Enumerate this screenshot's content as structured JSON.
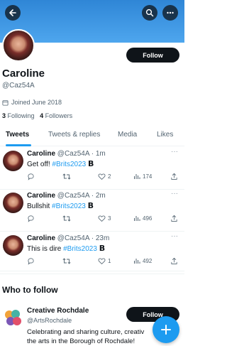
{
  "profile": {
    "name": "Caroline",
    "handle": "@Caz54A",
    "joined": "Joined June 2018",
    "following_count": "3",
    "following_label": "Following",
    "followers_count": "4",
    "followers_label": "Followers",
    "follow_label": "Follow"
  },
  "tabs": [
    {
      "label": "Tweets",
      "active": true
    },
    {
      "label": "Tweets & replies",
      "active": false
    },
    {
      "label": "Media",
      "active": false
    },
    {
      "label": "Likes",
      "active": false
    }
  ],
  "tweets": [
    {
      "name": "Caroline",
      "handle": "@Caz54A",
      "time": "· 1m",
      "text": "Get off! ",
      "hashtag": "#Brits2023",
      "replies": "",
      "retweets": "",
      "likes": "2",
      "views": "174"
    },
    {
      "name": "Caroline",
      "handle": "@Caz54A",
      "time": "· 2m",
      "text": "Bullshit ",
      "hashtag": "#Brits2023",
      "replies": "",
      "retweets": "",
      "likes": "3",
      "views": "496"
    },
    {
      "name": "Caroline",
      "handle": "@Caz54A",
      "time": "· 23m",
      "text": "This is dire ",
      "hashtag": "#Brits2023",
      "replies": "",
      "retweets": "",
      "likes": "1",
      "views": "492"
    }
  ],
  "who_to_follow": {
    "title": "Who to follow",
    "suggestion": {
      "name": "Creative Rochdale",
      "handle": "@ArtsRochdale",
      "bio_line1": "Celebrating and sharing culture, creativ",
      "bio_line2": "the arts in the Borough of Rochdale!",
      "follow_label": "Follow"
    }
  },
  "brand_glyph": "B",
  "colors": {
    "accent": "#1d9bf0",
    "banner": "#3d96e3",
    "text": "#0f1419",
    "muted": "#536471"
  },
  "icons": [
    "back-arrow-icon",
    "search-icon",
    "more-icon",
    "calendar-icon",
    "reply-icon",
    "retweet-icon",
    "like-icon",
    "views-icon",
    "share-icon",
    "compose-plus-icon"
  ]
}
